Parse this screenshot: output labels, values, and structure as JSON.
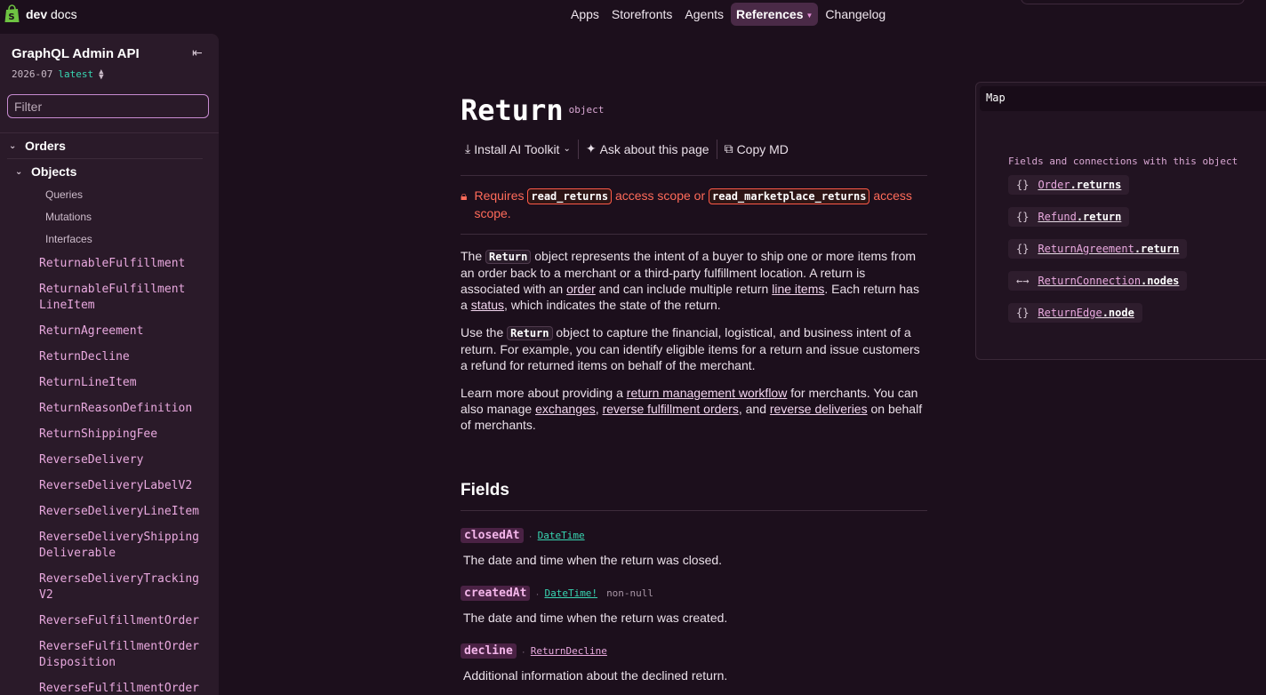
{
  "brand": {
    "name_bold": "dev",
    "name_rest": " docs",
    "color": "#6ec342"
  },
  "nav": [
    {
      "label": "Apps"
    },
    {
      "label": "Storefronts"
    },
    {
      "label": "Agents"
    },
    {
      "label": "References",
      "active": true
    },
    {
      "label": "Changelog"
    }
  ],
  "sidebar": {
    "title": "GraphQL Admin API",
    "version": "2026-07",
    "latest": "latest",
    "filter_placeholder": "Filter",
    "group_orders": "Orders",
    "group_objects": "Objects",
    "sub_items": [
      "Queries",
      "Mutations",
      "Interfaces"
    ],
    "items": [
      "ReturnableFulfillment",
      "ReturnableFulfillment\nLineItem",
      "ReturnAgreement",
      "ReturnDecline",
      "ReturnLineItem",
      "ReturnReasonDefinition",
      "ReturnShippingFee",
      "ReverseDelivery",
      "ReverseDeliveryLabelV2",
      "ReverseDeliveryLineItem",
      "ReverseDeliveryShipping\nDeliverable",
      "ReverseDeliveryTracking\nV2",
      "ReverseFulfillmentOrder",
      "ReverseFulfillmentOrder\nDisposition",
      "ReverseFulfillmentOrder"
    ]
  },
  "page": {
    "title": "Return",
    "tag": "object",
    "toolbar": {
      "install": "Install AI Toolkit",
      "ask": "Ask about this page",
      "copy": "Copy MD"
    },
    "scope": {
      "requires": "Requires",
      "scope1": "read_returns",
      "or": "access scope or",
      "scope2": "read_marketplace_returns",
      "suffix": "access scope."
    },
    "p1": {
      "a": "The",
      "code": "Return",
      "b": "object represents the intent of a buyer to ship one or more items from an order back to a merchant or a third-party fulfillment location. A return is associated with an",
      "link1": "order",
      "c": "and can include multiple return",
      "link2": "line items",
      "d": ". Each return has a",
      "link3": "status",
      "e": ", which indicates the state of the return."
    },
    "p2": {
      "a": "Use the",
      "code": "Return",
      "b": "object to capture the financial, logistical, and business intent of a return. For example, you can identify eligible items for a return and issue customers a refund for returned items on behalf of the merchant."
    },
    "p3": {
      "a": "Learn more about providing a",
      "link1": "return management workflow",
      "b": "for merchants. You can also manage",
      "link2": "exchanges",
      "c": ",",
      "link3": "reverse fulfillment orders",
      "d": ", and",
      "link4": "reverse deliveries",
      "e": "on behalf of merchants."
    },
    "fields_heading": "Fields",
    "fields": [
      {
        "name": "closedAt",
        "type": "DateTime",
        "non_null": "",
        "desc": "The date and time when the return was closed."
      },
      {
        "name": "createdAt",
        "type": "DateTime!",
        "non_null": "non-null",
        "desc": "The date and time when the return was created."
      },
      {
        "name": "decline",
        "type": "ReturnDecline",
        "non_null": "",
        "desc": "Additional information about the declined return."
      }
    ]
  },
  "map": {
    "title": "Map",
    "label": "Fields and connections with this object",
    "chips": [
      {
        "icon": "{}",
        "type": "Order",
        "field": ".returns"
      },
      {
        "icon": "{}",
        "type": "Refund",
        "field": ".return"
      },
      {
        "icon": "{}",
        "type": "ReturnAgreement",
        "field": ".return"
      },
      {
        "icon": "←→",
        "type": "ReturnConnection",
        "field": ".nodes"
      },
      {
        "icon": "{}",
        "type": "ReturnEdge",
        "field": ".node"
      }
    ]
  }
}
